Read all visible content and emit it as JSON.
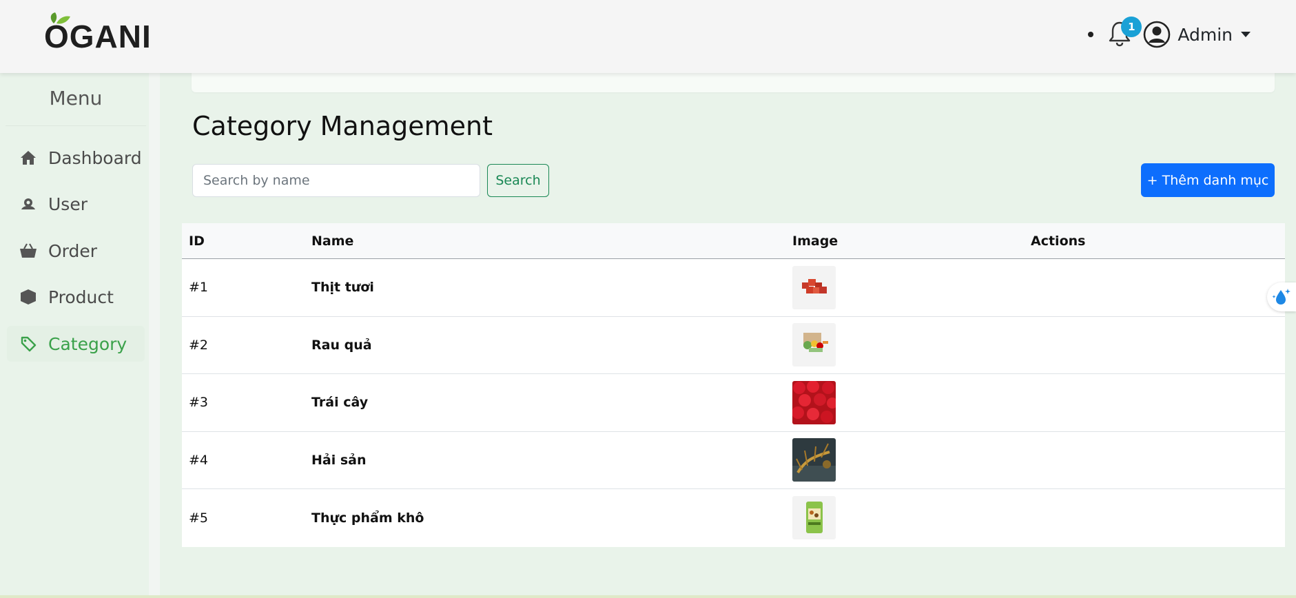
{
  "header": {
    "logo_text": "OGANI",
    "notification_count": "1",
    "user_label": "Admin"
  },
  "sidebar": {
    "title": "Menu",
    "items": [
      {
        "label": "Dashboard",
        "icon": "home-icon",
        "active": false
      },
      {
        "label": "User",
        "icon": "user-icon",
        "active": false
      },
      {
        "label": "Order",
        "icon": "basket-icon",
        "active": false
      },
      {
        "label": "Product",
        "icon": "box-icon",
        "active": false
      },
      {
        "label": "Category",
        "icon": "tag-icon",
        "active": true
      }
    ]
  },
  "main": {
    "title": "Category Management",
    "search": {
      "placeholder": "Search by name",
      "value": "",
      "button_label": "Search"
    },
    "add_button_label": "+ Thêm danh mục",
    "table": {
      "columns": [
        "ID",
        "Name",
        "Image",
        "Actions"
      ],
      "rows": [
        {
          "id": "#1",
          "name": "Thịt tươi",
          "image": "meat-cubes-image"
        },
        {
          "id": "#2",
          "name": "Rau quả",
          "image": "vegetable-box-image"
        },
        {
          "id": "#3",
          "name": "Trái cây",
          "image": "strawberries-image"
        },
        {
          "id": "#4",
          "name": "Hải sản",
          "image": "lobster-image"
        },
        {
          "id": "#5",
          "name": "Thực phẩm khô",
          "image": "dry-food-pack-image"
        }
      ]
    }
  },
  "colors": {
    "accent_green": "#3aa14a",
    "primary_blue": "#0d6efd",
    "outline_green": "#198754",
    "badge_blue": "#1aa1d6",
    "background": "#e9f3ea"
  }
}
